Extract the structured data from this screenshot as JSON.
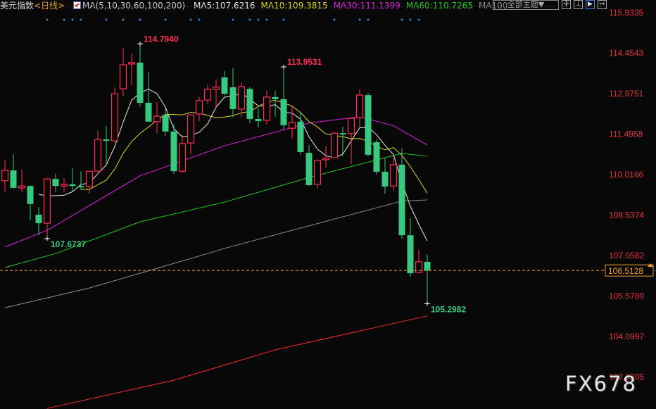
{
  "header": {
    "symbol": "美元指数",
    "period": "<日线>",
    "ma_params": "MA(5,10,30,60,100,200)",
    "ma_readouts": [
      {
        "label": "MA5:107.6216",
        "color": "#e8e8e8"
      },
      {
        "label": "MA10:109.3815",
        "color": "#d8d820"
      },
      {
        "label": "MA30:111.1399",
        "color": "#e020e0"
      },
      {
        "label": "MA60:110.7265",
        "color": "#20c820"
      },
      {
        "label": "MA100",
        "color": "#909090"
      }
    ]
  },
  "toolbar": {
    "theme_label": "全部主题▼",
    "buttons": [
      "✣",
      "⊥",
      "▶",
      "↦"
    ]
  },
  "watermark": "FX678",
  "chart_data": {
    "type": "candlestick",
    "ylim": [
      101.9,
      116.3
    ],
    "y_ticks": [
      "115.9335",
      "114.4543",
      "112.9751",
      "111.4958",
      "110.0166",
      "108.5374",
      "107.0582",
      "105.5789",
      "104.0997",
      "102.6205"
    ],
    "current_price": "106.5128",
    "annotations": [
      {
        "text": "114.7940",
        "index": 16,
        "price": 114.794,
        "kind": "high"
      },
      {
        "text": "113.9531",
        "index": 33,
        "price": 113.9531,
        "kind": "high"
      },
      {
        "text": "107.6737",
        "index": 5,
        "price": 107.6737,
        "kind": "low"
      },
      {
        "text": "105.2982",
        "index": 50,
        "price": 105.2982,
        "kind": "low"
      }
    ],
    "markers": [
      5,
      7,
      8,
      9,
      12,
      14,
      16,
      19,
      22,
      23,
      27,
      29,
      30,
      31,
      33,
      39,
      42,
      43,
      47,
      48,
      49
    ],
    "ohlc": [
      [
        109.79,
        110.56,
        109.37,
        110.17
      ],
      [
        110.17,
        110.76,
        109.5,
        109.53
      ],
      [
        109.53,
        110.22,
        109.37,
        109.6
      ],
      [
        109.6,
        109.62,
        108.34,
        108.94
      ],
      [
        108.55,
        108.83,
        107.8,
        108.24
      ],
      [
        108.24,
        109.89,
        107.6737,
        109.86
      ],
      [
        109.86,
        110.04,
        109.37,
        109.6
      ],
      [
        109.6,
        109.89,
        109.37,
        109.66
      ],
      [
        109.66,
        110.25,
        109.37,
        109.6
      ],
      [
        109.6,
        110.14,
        109.45,
        109.55
      ],
      [
        109.58,
        110.14,
        109.32,
        110.14
      ],
      [
        110.14,
        111.61,
        110.14,
        111.3
      ],
      [
        111.3,
        111.79,
        110.43,
        111.25
      ],
      [
        111.25,
        113.21,
        111.25,
        112.97
      ],
      [
        113.15,
        114.65,
        112.87,
        114.03
      ],
      [
        114.06,
        114.44,
        113.29,
        114.11
      ],
      [
        114.11,
        114.794,
        112.51,
        112.64
      ],
      [
        112.64,
        113.77,
        111.95,
        111.95
      ],
      [
        111.95,
        112.67,
        111.53,
        112.15
      ],
      [
        112.2,
        112.46,
        111.43,
        111.59
      ],
      [
        111.59,
        111.87,
        110.04,
        110.14
      ],
      [
        110.14,
        111.46,
        110.09,
        111.15
      ],
      [
        111.17,
        112.2,
        110.76,
        112.2
      ],
      [
        112.23,
        112.85,
        111.97,
        112.72
      ],
      [
        112.74,
        113.31,
        112.59,
        113.13
      ],
      [
        113.13,
        113.49,
        112.41,
        113.21
      ],
      [
        113.57,
        113.8,
        112.92,
        112.97
      ],
      [
        113.21,
        113.9,
        112.1,
        112.41
      ],
      [
        112.41,
        113.39,
        112.1,
        113.23
      ],
      [
        113.15,
        113.21,
        111.89,
        112.05
      ],
      [
        112.05,
        112.43,
        111.74,
        111.97
      ],
      [
        112.0,
        113.08,
        111.84,
        112.85
      ],
      [
        112.85,
        113.08,
        112.13,
        112.77
      ],
      [
        112.77,
        113.9531,
        111.66,
        111.82
      ],
      [
        111.71,
        112.51,
        111.33,
        111.92
      ],
      [
        111.95,
        112.31,
        110.74,
        110.84
      ],
      [
        110.81,
        111.1,
        109.6,
        109.63
      ],
      [
        109.66,
        110.58,
        109.5,
        110.53
      ],
      [
        110.56,
        111.05,
        110.27,
        110.61
      ],
      [
        110.63,
        111.53,
        110.63,
        111.53
      ],
      [
        111.53,
        111.77,
        110.69,
        111.51
      ],
      [
        111.51,
        112.07,
        110.4,
        112.07
      ],
      [
        112.1,
        113.13,
        111.77,
        112.92
      ],
      [
        112.92,
        113.0,
        110.69,
        110.74
      ],
      [
        111.2,
        111.3,
        110.02,
        110.12
      ],
      [
        110.12,
        110.61,
        109.32,
        109.58
      ],
      [
        109.6,
        110.61,
        109.42,
        110.38
      ],
      [
        110.38,
        110.97,
        107.68,
        107.8
      ],
      [
        107.8,
        108.42,
        106.29,
        106.41
      ],
      [
        106.44,
        107.26,
        106.44,
        106.83
      ],
      [
        106.83,
        107.09,
        105.2982,
        106.5128
      ]
    ],
    "ma_lines": [
      {
        "name": "MA30",
        "color": "#e020e0",
        "points": [
          [
            0,
            107.37
          ],
          [
            5,
            107.98
          ],
          [
            16,
            109.97
          ],
          [
            26,
            111.07
          ],
          [
            36,
            111.9
          ],
          [
            42,
            112.13
          ],
          [
            46,
            111.8
          ],
          [
            50,
            111.1
          ]
        ]
      },
      {
        "name": "MA60",
        "color": "#20c820",
        "points": [
          [
            0,
            106.62
          ],
          [
            6,
            107.13
          ],
          [
            16,
            108.29
          ],
          [
            26,
            109.01
          ],
          [
            36,
            109.91
          ],
          [
            47,
            110.79
          ],
          [
            50,
            110.69
          ]
        ]
      },
      {
        "name": "MA100",
        "color": "#909090",
        "points": [
          [
            0,
            105.15
          ],
          [
            10,
            105.87
          ],
          [
            24,
            107.13
          ],
          [
            26,
            107.32
          ],
          [
            47,
            109.05
          ],
          [
            50,
            109.09
          ]
        ]
      },
      {
        "name": "MA200",
        "color": "#ff2a2a",
        "points": [
          [
            5,
            101.47
          ],
          [
            20,
            102.5
          ],
          [
            32,
            103.61
          ],
          [
            50,
            104.85
          ]
        ]
      }
    ],
    "computed_ma": [
      {
        "name": "MA5",
        "period": 5,
        "color": "#e8e8e8"
      },
      {
        "name": "MA10",
        "period": 10,
        "color": "#d8d820"
      }
    ],
    "up_color": "#ff3050",
    "down_color": "#38c880",
    "tick_color": "#e8343b"
  }
}
